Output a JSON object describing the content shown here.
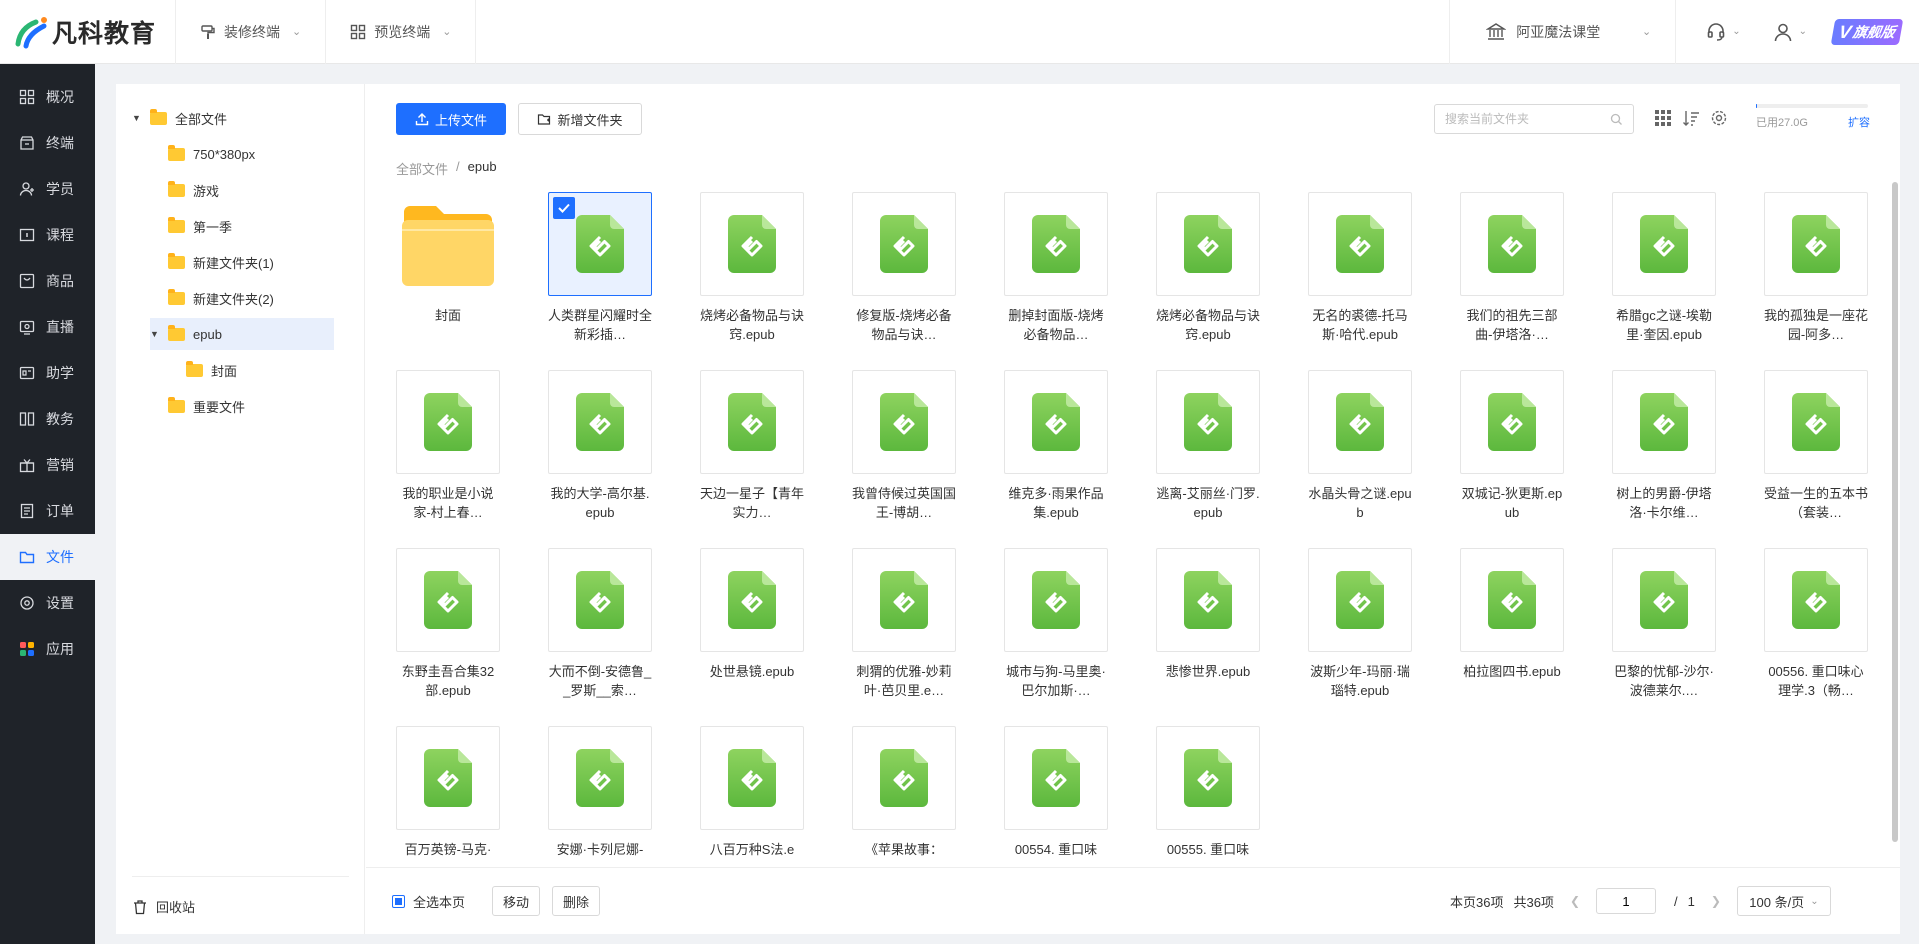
{
  "brand": {
    "name": "凡科教育"
  },
  "topnav": [
    {
      "label": "装修终端",
      "icon": "paint-roller-icon"
    },
    {
      "label": "预览终端",
      "icon": "grid-preview-icon"
    }
  ],
  "org": {
    "name": "阿亚魔法课堂"
  },
  "badge": {
    "v": "V",
    "label": "旗舰版"
  },
  "sidebar": {
    "items": [
      {
        "label": "概况",
        "icon": "overview-icon"
      },
      {
        "label": "终端",
        "icon": "terminal-icon"
      },
      {
        "label": "学员",
        "icon": "students-icon"
      },
      {
        "label": "课程",
        "icon": "course-icon"
      },
      {
        "label": "商品",
        "icon": "product-icon"
      },
      {
        "label": "直播",
        "icon": "live-icon"
      },
      {
        "label": "助学",
        "icon": "assist-icon"
      },
      {
        "label": "教务",
        "icon": "academic-icon"
      },
      {
        "label": "营销",
        "icon": "marketing-icon"
      },
      {
        "label": "订单",
        "icon": "order-icon"
      },
      {
        "label": "文件",
        "icon": "folder-icon",
        "active": true
      },
      {
        "label": "设置",
        "icon": "settings-icon"
      },
      {
        "label": "应用",
        "icon": "apps-icon"
      }
    ]
  },
  "tree": {
    "root": "全部文件",
    "items": [
      "750*380px",
      "游戏",
      "第一季",
      "新建文件夹(1)",
      "新建文件夹(2)",
      "epub",
      "封面",
      "重要文件"
    ],
    "trash": "回收站"
  },
  "toolbar": {
    "upload": "上传文件",
    "new_folder": "新增文件夹",
    "search_placeholder": "搜索当前文件夹",
    "storage_used": "已用27.0G",
    "storage_fraction": 0.01,
    "expand": "扩容"
  },
  "breadcrumb": {
    "root": "全部文件",
    "sep": "/",
    "current": "epub"
  },
  "files": [
    {
      "name": "封面",
      "type": "folder"
    },
    {
      "name": "人类群星闪耀时全新彩插…",
      "type": "epub",
      "selected": true
    },
    {
      "name": "烧烤必备物品与诀窍.epub",
      "type": "epub"
    },
    {
      "name": "修复版-烧烤必备物品与诀…",
      "type": "epub"
    },
    {
      "name": "删掉封面版-烧烤必备物品…",
      "type": "epub"
    },
    {
      "name": "烧烤必备物品与诀窍.epub",
      "type": "epub"
    },
    {
      "name": "无名的裘德-托马斯·哈代.epub",
      "type": "epub"
    },
    {
      "name": "我们的祖先三部曲-伊塔洛·…",
      "type": "epub"
    },
    {
      "name": "希腊gc之谜-埃勒里·奎因.epub",
      "type": "epub"
    },
    {
      "name": "我的孤独是一座花园-阿多…",
      "type": "epub"
    },
    {
      "name": "我的职业是小说家-村上春…",
      "type": "epub"
    },
    {
      "name": "我的大学-高尔基.epub",
      "type": "epub"
    },
    {
      "name": "天边一星子【青年实力…",
      "type": "epub"
    },
    {
      "name": "我曾侍候过英国国王-博胡…",
      "type": "epub"
    },
    {
      "name": "维克多·雨果作品集.epub",
      "type": "epub"
    },
    {
      "name": "逃离-艾丽丝·门罗.epub",
      "type": "epub"
    },
    {
      "name": "水晶头骨之谜.epub",
      "type": "epub"
    },
    {
      "name": "双城记-狄更斯.epub",
      "type": "epub"
    },
    {
      "name": "树上的男爵-伊塔洛·卡尔维…",
      "type": "epub"
    },
    {
      "name": "受益一生的五本书（套装…",
      "type": "epub"
    },
    {
      "name": "东野圭吾合集32部.epub",
      "type": "epub"
    },
    {
      "name": "大而不倒-安德鲁__罗斯__索…",
      "type": "epub"
    },
    {
      "name": "处世悬镜.epub",
      "type": "epub"
    },
    {
      "name": "刺猬的优雅-妙莉叶·芭贝里.e…",
      "type": "epub"
    },
    {
      "name": "城市与狗-马里奥·巴尔加斯·…",
      "type": "epub"
    },
    {
      "name": "悲惨世界.epub",
      "type": "epub"
    },
    {
      "name": "波斯少年-玛丽·瑞瑙特.epub",
      "type": "epub"
    },
    {
      "name": "柏拉图四书.epub",
      "type": "epub"
    },
    {
      "name": "巴黎的忧郁-沙尔·波德莱尔.…",
      "type": "epub"
    },
    {
      "name": "00556. 重口味心理学.3（畅…",
      "type": "epub"
    },
    {
      "name": "百万英镑-马克·",
      "type": "epub"
    },
    {
      "name": "安娜·卡列尼娜-",
      "type": "epub"
    },
    {
      "name": "八百万种S法.e",
      "type": "epub"
    },
    {
      "name": "《苹果故事：",
      "type": "epub"
    },
    {
      "name": "00554. 重口味",
      "type": "epub"
    },
    {
      "name": "00555. 重口味",
      "type": "epub"
    }
  ],
  "footer": {
    "select_all": "全选本页",
    "move": "移动",
    "delete": "删除",
    "page_info": "本页36项",
    "total": "共36项",
    "page": "1",
    "page_sep": "/",
    "page_total": "1",
    "page_size": "100 条/页"
  },
  "colors": {
    "accent": "#1e6fff",
    "sidebar": "#1f2329",
    "epub_green": "#6cc24a",
    "folder": "#ffc933"
  }
}
